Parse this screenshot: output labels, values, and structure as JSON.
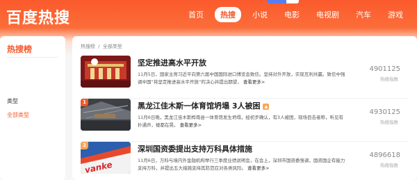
{
  "app": {
    "logo": "百度热搜",
    "colors": {
      "brand": "#f3582b",
      "rank_1": "#f3582b",
      "rank_2": "#f8a65a"
    }
  },
  "nav": {
    "items": [
      {
        "label": "首页",
        "active": false
      },
      {
        "label": "热搜",
        "active": true
      },
      {
        "label": "小说",
        "active": false
      },
      {
        "label": "电影",
        "active": false
      },
      {
        "label": "电视剧",
        "active": false
      },
      {
        "label": "汽车",
        "active": false
      },
      {
        "label": "游戏",
        "active": false
      }
    ]
  },
  "sidebar": {
    "title": "热搜榜",
    "type_label": "类型",
    "all_types": "全部类型"
  },
  "breadcrumb": {
    "root": "热搜榜",
    "sep": "/",
    "current": "全部类型"
  },
  "items": [
    {
      "rank": "",
      "title": "坚定推进高水平开放",
      "desc": "11月5日，国家主席习近平向第六届中国国际进口博览会致信。坚持对外开放，实现互利共赢。致信中强调中国“将坚定推进高水平开放”的决心并提出期望，",
      "more": "查看更多>",
      "score": "4901125",
      "score_label": "热搜指数",
      "thumb_icon": "expo-building-image"
    },
    {
      "rank": "1",
      "title": "黑龙江佳木斯一体育馆坍塌 3人被困",
      "desc": "11月6日晚，黑龙江佳木斯桦南县一体育馆发生坍塌，经初步确认，有3人被困，现场目击者称，听见有扑通声，楼都在晃，",
      "more": "查看更多>",
      "score": "4930125",
      "score_label": "热搜指数",
      "thumb_icon": "collapsed-gym-image"
    },
    {
      "rank": "2",
      "title": "深圳国资委提出支持万科具体措施",
      "desc": "11月6日，万科与境内外金融机构举行三季度业绩说明会，在会上，深圳市国资委强调，国资国企有能力支持万科，并提出五大措施支持其防范应对各类风险。",
      "more": "查看更多>",
      "score": "4896618",
      "score_label": "热搜指数",
      "thumb_icon": "vanke-sign-image"
    }
  ]
}
